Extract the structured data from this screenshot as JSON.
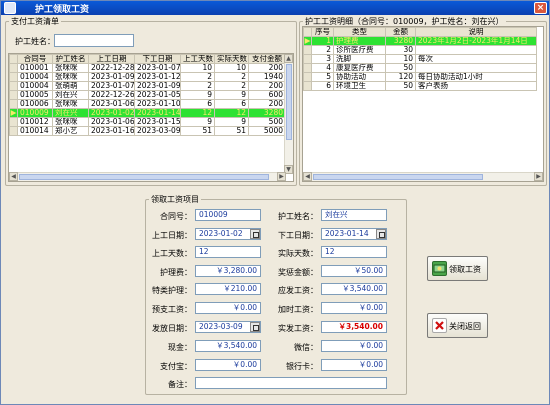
{
  "window": {
    "title": "护工领取工资",
    "close_glyph": "×"
  },
  "left_panel": {
    "legend": "支付工资清单",
    "search_label": "护工姓名：",
    "search_value": "",
    "columns": [
      "合同号",
      "护工姓名",
      "上工日期",
      "下工日期",
      "上工天数",
      "实际天数",
      "支付金额"
    ],
    "rows": [
      [
        "010001",
        "张咪咪",
        "2022-12-28",
        "2023-01-07",
        "10",
        "10",
        "200"
      ],
      [
        "010004",
        "张咪咪",
        "2023-01-09",
        "2023-01-12",
        "2",
        "2",
        "1940"
      ],
      [
        "010004",
        "张萌萌",
        "2023-01-07",
        "2023-01-09",
        "2",
        "2",
        "200"
      ],
      [
        "010005",
        "刘在兴",
        "2022-12-26",
        "2023-01-05",
        "9",
        "9",
        "600"
      ],
      [
        "010006",
        "张咪咪",
        "2023-01-06",
        "2023-01-10",
        "6",
        "6",
        "200"
      ],
      [
        "010009",
        "刘在兴",
        "2023-01-02",
        "2023-01-14",
        "12",
        "12",
        "3280"
      ],
      [
        "010012",
        "张咪咪",
        "2023-01-06",
        "2023-01-15",
        "9",
        "9",
        "500"
      ],
      [
        "010014",
        "郑小艺",
        "2023-01-16",
        "2023-03-09",
        "51",
        "51",
        "5000"
      ]
    ],
    "selected_row": 5
  },
  "right_panel": {
    "legend": "护工工资明细（合同号：010009，护工姓名：刘在兴）",
    "columns": [
      "序号",
      "类型",
      "金额",
      "说明"
    ],
    "rows": [
      [
        "1",
        "护理费",
        "3280",
        "2023年1月2日-2023年1月14日"
      ],
      [
        "2",
        "诊所医疗费",
        "30",
        ""
      ],
      [
        "3",
        "洗脚",
        "10",
        "每次"
      ],
      [
        "4",
        "康复医疗费",
        "50",
        ""
      ],
      [
        "5",
        "协助活动",
        "120",
        "每日协助活动1小时"
      ],
      [
        "6",
        "环境卫生",
        "50",
        "客户表扬"
      ]
    ],
    "selected_row": 0
  },
  "form": {
    "legend": "领取工资项目",
    "contract_no": {
      "label": "合同号：",
      "value": "010009"
    },
    "worker_name": {
      "label": "护工姓名：",
      "value": "刘在兴"
    },
    "start_date": {
      "label": "上工日期：",
      "value": "2023-01-02"
    },
    "end_date": {
      "label": "下工日期：",
      "value": "2023-01-14"
    },
    "work_days": {
      "label": "上工天数：",
      "value": "12"
    },
    "actual_days": {
      "label": "实际天数：",
      "value": "12"
    },
    "care_fee": {
      "label": "护理费：",
      "value": "￥3,280.00"
    },
    "bonus": {
      "label": "奖惩金额：",
      "value": "￥50.00"
    },
    "special_care": {
      "label": "特类护理：",
      "value": "￥210.00"
    },
    "payable": {
      "label": "应发工资：",
      "value": "￥3,540.00"
    },
    "advance": {
      "label": "预支工资：",
      "value": "￥0.00"
    },
    "overtime": {
      "label": "加时工资：",
      "value": "￥0.00"
    },
    "pay_date": {
      "label": "发放日期：",
      "value": "2023-03-09"
    },
    "actual_pay": {
      "label": "实发工资：",
      "value": "￥3,540.00"
    },
    "cash": {
      "label": "现金：",
      "value": "￥3,540.00"
    },
    "wechat": {
      "label": "微信：",
      "value": "￥0.00"
    },
    "alipay": {
      "label": "支付宝：",
      "value": "￥0.00"
    },
    "bank_card": {
      "label": "银行卡：",
      "value": "￥0.00"
    },
    "remark": {
      "label": "备注：",
      "value": ""
    }
  },
  "buttons": {
    "receive_label": "领取工资",
    "close_label": "关闭返回"
  },
  "colors": {
    "selected_row": "#2ee233",
    "title_bar": "#0a4fc8",
    "red_value": "#d80000"
  }
}
